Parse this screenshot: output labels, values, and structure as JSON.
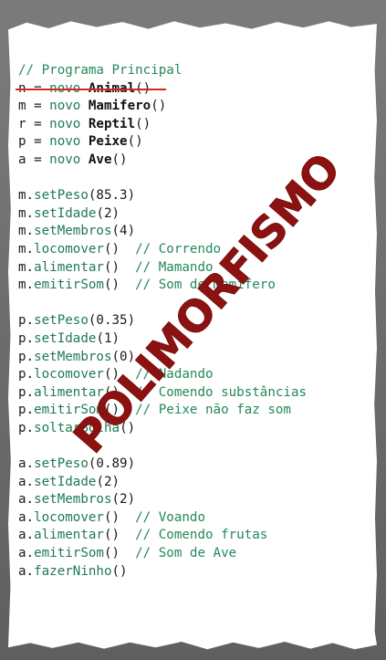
{
  "stamp_text": "POLIMORFISMO",
  "code": {
    "comment_title": "// Programa Principal",
    "decl": [
      {
        "var": "n",
        "op": " = ",
        "kw": "novo",
        "cls": "Animal",
        "paren": "()"
      },
      {
        "var": "m",
        "op": " = ",
        "kw": "novo",
        "cls": "Mamifero",
        "paren": "()"
      },
      {
        "var": "r",
        "op": " = ",
        "kw": "novo",
        "cls": "Reptil",
        "paren": "()"
      },
      {
        "var": "p",
        "op": " = ",
        "kw": "novo",
        "cls": "Peixe",
        "paren": "()"
      },
      {
        "var": "a",
        "op": " = ",
        "kw": "novo",
        "cls": "Ave",
        "paren": "()"
      }
    ],
    "m_block": [
      {
        "obj": "m.",
        "method": "setPeso",
        "args": "(85.3)",
        "comment": ""
      },
      {
        "obj": "m.",
        "method": "setIdade",
        "args": "(2)",
        "comment": ""
      },
      {
        "obj": "m.",
        "method": "setMembros",
        "args": "(4)",
        "comment": ""
      },
      {
        "obj": "m.",
        "method": "locomover",
        "args": "()",
        "comment": "  // Correndo"
      },
      {
        "obj": "m.",
        "method": "alimentar",
        "args": "()",
        "comment": "  // Mamando"
      },
      {
        "obj": "m.",
        "method": "emitirSom",
        "args": "()",
        "comment": "  // Som de Mamífero"
      }
    ],
    "p_block": [
      {
        "obj": "p.",
        "method": "setPeso",
        "args": "(0.35)",
        "comment": ""
      },
      {
        "obj": "p.",
        "method": "setIdade",
        "args": "(1)",
        "comment": ""
      },
      {
        "obj": "p.",
        "method": "setMembros",
        "args": "(0)",
        "comment": ""
      },
      {
        "obj": "p.",
        "method": "locomover",
        "args": "()",
        "comment": "  // Nadando"
      },
      {
        "obj": "p.",
        "method": "alimentar",
        "args": "()",
        "comment": "  // Comendo substâncias"
      },
      {
        "obj": "p.",
        "method": "emitirSom",
        "args": "()",
        "comment": "  // Peixe não faz som"
      },
      {
        "obj": "p.",
        "method": "soltarBolha",
        "args": "()",
        "comment": ""
      }
    ],
    "a_block": [
      {
        "obj": "a.",
        "method": "setPeso",
        "args": "(0.89)",
        "comment": ""
      },
      {
        "obj": "a.",
        "method": "setIdade",
        "args": "(2)",
        "comment": ""
      },
      {
        "obj": "a.",
        "method": "setMembros",
        "args": "(2)",
        "comment": ""
      },
      {
        "obj": "a.",
        "method": "locomover",
        "args": "()",
        "comment": "  // Voando"
      },
      {
        "obj": "a.",
        "method": "alimentar",
        "args": "()",
        "comment": "  // Comendo frutas"
      },
      {
        "obj": "a.",
        "method": "emitirSom",
        "args": "()",
        "comment": "  // Som de Ave"
      },
      {
        "obj": "a.",
        "method": "fazerNinho",
        "args": "()",
        "comment": ""
      }
    ]
  },
  "colors": {
    "stamp": "#8c1212",
    "keyword": "#1f7a52",
    "strike": "#d42828"
  }
}
